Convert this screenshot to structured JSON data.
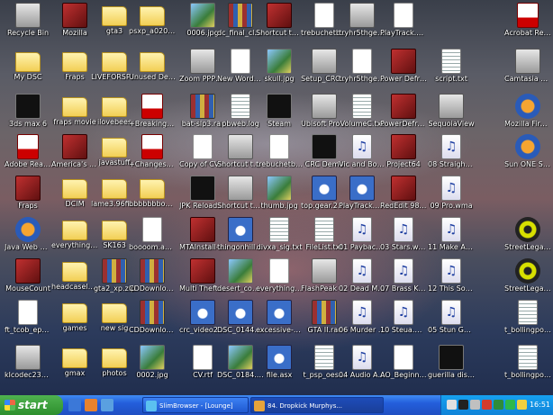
{
  "desktop": {
    "icons": [
      {
        "label": "Recycle Bin",
        "icon": "recycle-bin-icon",
        "kind": "exe"
      },
      {
        "label": "Mozilla",
        "icon": "mozilla-icon",
        "kind": "app"
      },
      {
        "label": "gta3",
        "icon": "folder-icon",
        "kind": "folder"
      },
      {
        "label": "psxp_a0206...",
        "icon": "folder-icon",
        "kind": "folder"
      },
      {
        "label": "0006.jpg",
        "icon": "image-file-icon",
        "kind": "image"
      },
      {
        "label": "dc_final_cle...",
        "icon": "archive-icon",
        "kind": "archive"
      },
      {
        "label": "Shortcut to ra2.exe",
        "icon": "shortcut-icon",
        "kind": "app"
      },
      {
        "label": "trebuchetbu...",
        "icon": "document-icon",
        "kind": "doc"
      },
      {
        "label": "tryhr5thgeh...",
        "icon": "document-icon",
        "kind": "exe"
      },
      {
        "label": "PlayTrack.aspx R1_Xmas_lec...",
        "icon": "web-page-icon",
        "kind": "doc"
      },
      {
        "label": "Acrobat Reader 5.0",
        "icon": "pdf-icon",
        "kind": "pdf"
      },
      {
        "label": "My DSC",
        "icon": "folder-icon",
        "kind": "folder"
      },
      {
        "label": "Fraps",
        "icon": "folder-icon",
        "kind": "folder"
      },
      {
        "label": "LIVEFORSPEED",
        "icon": "folder-icon",
        "kind": "folder"
      },
      {
        "label": "Unused Deskto...",
        "icon": "folder-icon",
        "kind": "folder"
      },
      {
        "label": "Zoom PPP_DSL",
        "icon": "network-icon",
        "kind": "exe"
      },
      {
        "label": "New Wordpad Document.doc",
        "icon": "document-icon",
        "kind": "doc"
      },
      {
        "label": "skull.jpg",
        "icon": "image-file-icon",
        "kind": "image"
      },
      {
        "label": "Setup_CRC_...",
        "icon": "setup-icon",
        "kind": "exe"
      },
      {
        "label": "tryhr5thgeh...",
        "icon": "document-icon",
        "kind": "blank"
      },
      {
        "label": "Power Defragment...",
        "icon": "defrag-icon",
        "kind": "app"
      },
      {
        "label": "script.txt",
        "icon": "text-file-icon",
        "kind": "text"
      },
      {
        "label": "Camtasia Studio 2",
        "icon": "camtasia-icon",
        "kind": "exe"
      },
      {
        "label": "3ds max 6",
        "icon": "3ds-max-icon",
        "kind": "shell"
      },
      {
        "label": "fraps movie",
        "icon": "folder-icon",
        "kind": "folder"
      },
      {
        "label": "ilovebees",
        "icon": "folder-icon",
        "kind": "folder"
      },
      {
        "label": "+Breaking+...",
        "icon": "pdf-icon",
        "kind": "pdf"
      },
      {
        "label": "bat-slp3.rar",
        "icon": "archive-icon",
        "kind": "archive"
      },
      {
        "label": "pbweb.log",
        "icon": "text-file-icon",
        "kind": "text"
      },
      {
        "label": "Steam",
        "icon": "steam-icon",
        "kind": "shell"
      },
      {
        "label": "Ubisoft Product Registration",
        "icon": "ubisoft-icon",
        "kind": "exe"
      },
      {
        "label": "VolumeC.txt",
        "icon": "text-file-icon",
        "kind": "text"
      },
      {
        "label": "PowerDefra...",
        "icon": "defrag-icon",
        "kind": "app"
      },
      {
        "label": "SequoiaView",
        "icon": "sequoiaview-icon",
        "kind": "exe"
      },
      {
        "label": "Mozilla Firefox",
        "icon": "firefox-icon",
        "kind": "web"
      },
      {
        "label": "Adobe Reader 6.0",
        "icon": "pdf-icon",
        "kind": "pdf"
      },
      {
        "label": "America's Army",
        "icon": "americas-army-icon",
        "kind": "app"
      },
      {
        "label": "javastuff",
        "icon": "folder-icon",
        "kind": "folder"
      },
      {
        "label": "+Changes+i...",
        "icon": "pdf-icon",
        "kind": "pdf"
      },
      {
        "label": "Copy of CV.rtf",
        "icon": "document-icon",
        "kind": "doc"
      },
      {
        "label": "Shortcut to aux.setup.exe",
        "icon": "shortcut-icon",
        "kind": "exe"
      },
      {
        "label": "trebuchetbu...",
        "icon": "document-icon",
        "kind": "doc"
      },
      {
        "label": "CRC Demo",
        "icon": "crc-icon",
        "kind": "shell"
      },
      {
        "label": "Vic and Bob BBC Licence ...",
        "icon": "audio-file-icon",
        "kind": "audio"
      },
      {
        "label": "Project64",
        "icon": "project64-icon",
        "kind": "app"
      },
      {
        "label": "08 Straight Jacket.wma",
        "icon": "audio-file-icon",
        "kind": "audio"
      },
      {
        "label": "Sun ONE Studio 5 SE",
        "icon": "sun-one-icon",
        "kind": "web"
      },
      {
        "label": "Fraps",
        "icon": "fraps-icon",
        "kind": "app"
      },
      {
        "label": "DCIM",
        "icon": "folder-icon",
        "kind": "folder"
      },
      {
        "label": "lame3.96fin...",
        "icon": "folder-icon",
        "kind": "folder"
      },
      {
        "label": "bbbbbbbooo...",
        "icon": "folder-icon",
        "kind": "folder"
      },
      {
        "label": "JPK Reloaded",
        "icon": "app-icon",
        "kind": "shell"
      },
      {
        "label": "Shortcut to gdi.exe",
        "icon": "shortcut-icon",
        "kind": "exe"
      },
      {
        "label": "thumb.jpg",
        "icon": "image-file-icon",
        "kind": "image"
      },
      {
        "label": "top.gear.26...",
        "icon": "media-file-icon",
        "kind": "media"
      },
      {
        "label": "PlayTrack.wax",
        "icon": "media-file-icon",
        "kind": "media"
      },
      {
        "label": "RedEdit 98 -Professional",
        "icon": "app-icon",
        "kind": "app"
      },
      {
        "label": "09 Pro.wma",
        "icon": "audio-file-icon",
        "kind": "audio"
      },
      {
        "label": "Java Web Start",
        "icon": "java-icon",
        "kind": "web"
      },
      {
        "label": "everything guide_files",
        "icon": "folder-icon",
        "kind": "folder"
      },
      {
        "label": "SK163",
        "icon": "folder-icon",
        "kind": "folder"
      },
      {
        "label": "boooom.avi.sfk",
        "icon": "document-icon",
        "kind": "blank"
      },
      {
        "label": "MTAInstall-0...",
        "icon": "app-icon",
        "kind": "app"
      },
      {
        "label": "thingonhill.wmv",
        "icon": "media-file-icon",
        "kind": "media"
      },
      {
        "label": "divxa_sig.txt",
        "icon": "text-file-icon",
        "kind": "text"
      },
      {
        "label": "FileList.txt",
        "icon": "text-file-icon",
        "kind": "text"
      },
      {
        "label": "01 Payback.wma",
        "icon": "audio-file-icon",
        "kind": "audio"
      },
      {
        "label": "03 Stars.wma",
        "icon": "audio-file-icon",
        "kind": "audio"
      },
      {
        "label": "11 Make A Move.wma",
        "icon": "audio-file-icon",
        "kind": "audio"
      },
      {
        "label": "StreetLegal...",
        "icon": "streetlegal-icon",
        "kind": "cog"
      },
      {
        "label": "MouseCount",
        "icon": "mousecount-icon",
        "kind": "app"
      },
      {
        "label": "headcaseladz",
        "icon": "folder-icon",
        "kind": "folder"
      },
      {
        "label": "gta2_xp.zip",
        "icon": "archive-icon",
        "kind": "archive"
      },
      {
        "label": "CDDownloa...",
        "icon": "archive-icon",
        "kind": "archive"
      },
      {
        "label": "Multi Theft Auto",
        "icon": "mta-icon",
        "kind": "app"
      },
      {
        "label": "desert_com...",
        "icon": "image-file-icon",
        "kind": "image"
      },
      {
        "label": "everything guide.htm",
        "icon": "web-page-icon",
        "kind": "doc"
      },
      {
        "label": "FlashPeak SlimBrowser",
        "icon": "slimbrowser-icon",
        "kind": "exe"
      },
      {
        "label": "02 Dead Man Walking.wma",
        "icon": "audio-file-icon",
        "kind": "audio"
      },
      {
        "label": "07 Brass Knuckes.wma",
        "icon": "audio-file-icon",
        "kind": "audio"
      },
      {
        "label": "12 This Song.wma",
        "icon": "audio-file-icon",
        "kind": "audio"
      },
      {
        "label": "StreetLegal...",
        "icon": "streetlegal-icon",
        "kind": "cog"
      },
      {
        "label": "ft_tcob_ep2...",
        "icon": "document-icon",
        "kind": "blank"
      },
      {
        "label": "games",
        "icon": "folder-icon",
        "kind": "folder"
      },
      {
        "label": "new sig",
        "icon": "folder-icon",
        "kind": "folder"
      },
      {
        "label": "CDDownload...",
        "icon": "archive-icon",
        "kind": "archive"
      },
      {
        "label": "crc_video2_...",
        "icon": "media-file-icon",
        "kind": "media"
      },
      {
        "label": "DSC_0144.AVI",
        "icon": "media-file-icon",
        "kind": "media"
      },
      {
        "label": "excessive-s...",
        "icon": "media-file-icon",
        "kind": "media"
      },
      {
        "label": "GTA II.rar",
        "icon": "archive-icon",
        "kind": "archive"
      },
      {
        "label": "06 Murder Frenzy.wma",
        "icon": "audio-file-icon",
        "kind": "audio"
      },
      {
        "label": "10 Steua.wma",
        "icon": "audio-file-icon",
        "kind": "audio"
      },
      {
        "label": "05 Stun Gun.wma",
        "icon": "audio-file-icon",
        "kind": "audio"
      },
      {
        "label": "t_bollingpoi...",
        "icon": "text-file-icon",
        "kind": "text"
      },
      {
        "label": "klcodec235f...",
        "icon": "codec-icon",
        "kind": "exe"
      },
      {
        "label": "gmax",
        "icon": "folder-icon",
        "kind": "folder"
      },
      {
        "label": "photos",
        "icon": "folder-icon",
        "kind": "folder"
      },
      {
        "label": "0002.jpg",
        "icon": "image-file-icon",
        "kind": "image"
      },
      {
        "label": "CV.rtf",
        "icon": "document-icon",
        "kind": "doc"
      },
      {
        "label": "DSC_0184.JPG",
        "icon": "image-file-icon",
        "kind": "image"
      },
      {
        "label": "file.asx",
        "icon": "media-file-icon",
        "kind": "media"
      },
      {
        "label": "t_psp_oes...",
        "icon": "text-file-icon",
        "kind": "text"
      },
      {
        "label": "04 Audio Amigos.wma",
        "icon": "audio-file-icon",
        "kind": "audio"
      },
      {
        "label": "AO_Beginne...",
        "icon": "document-icon",
        "kind": "doc"
      },
      {
        "label": "guerilla disco.veg",
        "icon": "vegas-icon",
        "kind": "shell"
      },
      {
        "label": "t_bollingpoi...",
        "icon": "text-file-icon",
        "kind": "text"
      }
    ]
  },
  "taskbar": {
    "start_label": "start",
    "quick_launch": [
      {
        "icon": "desktop-icon",
        "color": "#3b78d8"
      },
      {
        "icon": "firefox-icon",
        "color": "#e8822e"
      },
      {
        "icon": "media-player-icon",
        "color": "#5aa0e0"
      }
    ],
    "tasks": [
      {
        "label": "SlimBrowser - [Lounge]",
        "icon": "slimbrowser-icon",
        "color": "#5bc1f0",
        "active": false
      },
      {
        "label": "84. Dropkick Murphys...",
        "icon": "winamp-icon",
        "color": "#e6a33a",
        "active": true
      }
    ],
    "tray_icons": [
      {
        "icon": "network-tray-icon",
        "color": "#e0e0e0"
      },
      {
        "icon": "steam-tray-icon",
        "color": "#222222"
      },
      {
        "icon": "volume-tray-icon",
        "color": "#c0c0c0"
      },
      {
        "icon": "security-tray-icon",
        "color": "#d33c2c"
      },
      {
        "icon": "antivirus-tray-icon",
        "color": "#2e8c3a"
      },
      {
        "icon": "messenger-tray-icon",
        "color": "#2db84b"
      },
      {
        "icon": "tray-app-icon",
        "color": "#f0d040"
      }
    ],
    "clock": "16:51"
  }
}
